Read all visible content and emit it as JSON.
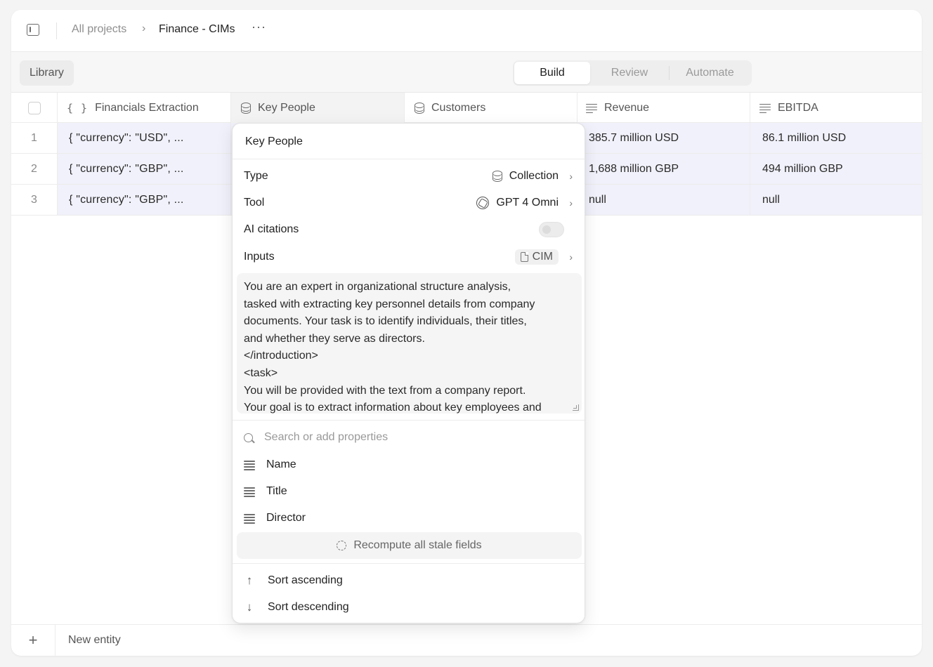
{
  "breadcrumb": {
    "root": "All projects",
    "separator": "›",
    "current": "Finance - CIMs",
    "more": "···"
  },
  "toolbar": {
    "library_label": "Library",
    "tabs": [
      {
        "label": "Build",
        "active": true
      },
      {
        "label": "Review",
        "active": false
      },
      {
        "label": "Automate",
        "active": false
      }
    ]
  },
  "table": {
    "columns": [
      {
        "label": "Financials Extraction",
        "icon": "braces-icon"
      },
      {
        "label": "Key People",
        "icon": "database-icon"
      },
      {
        "label": "Customers",
        "icon": "database-icon"
      },
      {
        "label": "Revenue",
        "icon": "text-lines-icon"
      },
      {
        "label": "EBITDA",
        "icon": "text-lines-icon"
      }
    ],
    "rows": [
      {
        "index": "1",
        "financials": "{  \"currency\": \"USD\",  ...",
        "revenue": "385.7 million USD",
        "ebitda": "86.1 million USD"
      },
      {
        "index": "2",
        "financials": "{  \"currency\": \"GBP\",  ...",
        "revenue": "1,688 million GBP",
        "ebitda": "494 million GBP"
      },
      {
        "index": "3",
        "financials": "{  \"currency\": \"GBP\",  ...",
        "revenue": "null",
        "ebitda": "null"
      }
    ],
    "new_entity_label": "New entity",
    "add_symbol": "+"
  },
  "popover": {
    "column_name": "Key People",
    "type_label": "Type",
    "type_value": "Collection",
    "tool_label": "Tool",
    "tool_value": "GPT 4 Omni",
    "citations_label": "AI citations",
    "citations_enabled": false,
    "inputs_label": "Inputs",
    "inputs_value": "CIM",
    "prompt_lines": [
      "You are an expert in organizational structure analysis,",
      "tasked with extracting key personnel details from company",
      "documents. Your task is to identify individuals, their titles,",
      "and whether they serve as directors.",
      "</introduction>",
      "<task>",
      "You will be provided with the text from a company report.",
      "Your goal is to extract information about key employees and"
    ],
    "search_placeholder": "Search or add properties",
    "properties": [
      "Name",
      "Title",
      "Director"
    ],
    "recompute_label": "Recompute all stale fields",
    "sort_ascending": "Sort ascending",
    "sort_descending": "Sort descending",
    "chevron": "›"
  },
  "colors": {
    "row_tint": "#f1f1fb",
    "background": "#f4f4f4"
  }
}
